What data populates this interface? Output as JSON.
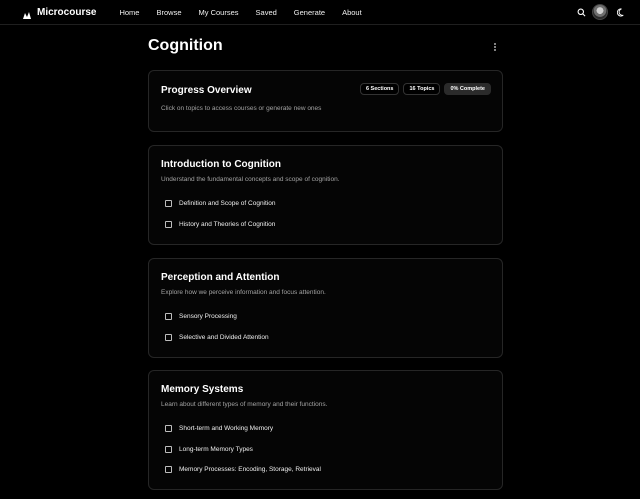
{
  "app": {
    "name": "Microcourse"
  },
  "nav": [
    "Home",
    "Browse",
    "My Courses",
    "Saved",
    "Generate",
    "About"
  ],
  "icons": {
    "logo": "microcourse-logo-icon",
    "search": "search-icon",
    "theme": "moon-icon",
    "more": "more-vertical-icon"
  },
  "page": {
    "title": "Cognition"
  },
  "progress": {
    "title": "Progress Overview",
    "desc": "Click on topics to access courses or generate new ones",
    "badges": [
      "6 Sections",
      "16 Topics",
      "0% Complete"
    ]
  },
  "sections": [
    {
      "title": "Introduction to Cognition",
      "desc": "Understand the fundamental concepts and scope of cognition.",
      "topics": [
        "Definition and Scope of Cognition",
        "History and Theories of Cognition"
      ]
    },
    {
      "title": "Perception and Attention",
      "desc": "Explore how we perceive information and focus attention.",
      "topics": [
        "Sensory Processing",
        "Selective and Divided Attention"
      ]
    },
    {
      "title": "Memory Systems",
      "desc": "Learn about different types of memory and their functions.",
      "topics": [
        "Short-term and Working Memory",
        "Long-term Memory Types",
        "Memory Processes: Encoding, Storage, Retrieval"
      ]
    }
  ]
}
